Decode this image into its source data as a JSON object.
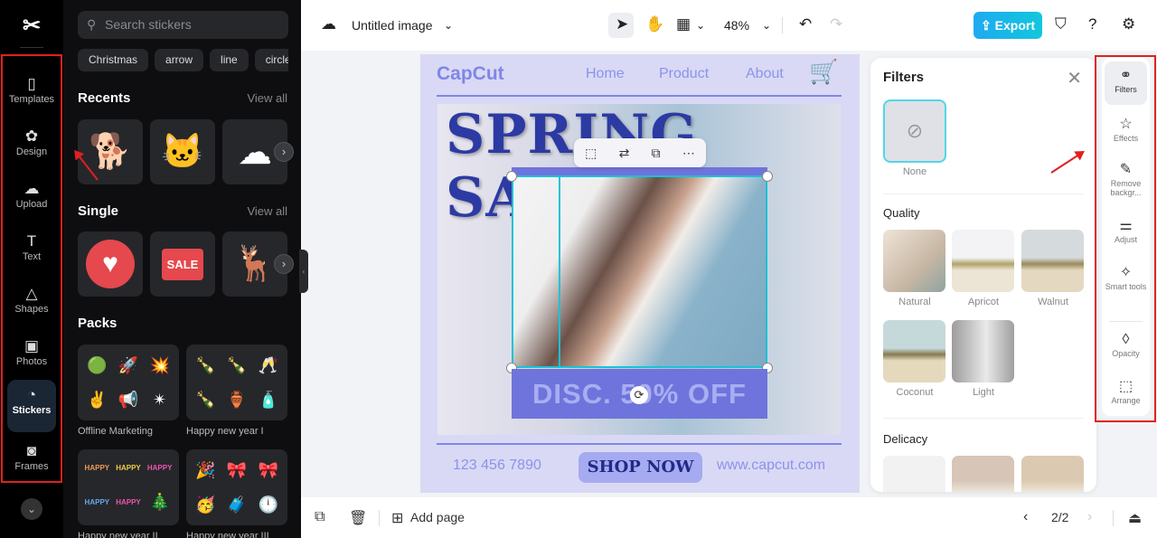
{
  "app": {
    "logo": "CapCut"
  },
  "rail": {
    "items": [
      {
        "label": "Templates",
        "icon": "templates-icon"
      },
      {
        "label": "Design",
        "icon": "design-icon"
      },
      {
        "label": "Upload",
        "icon": "upload-icon"
      },
      {
        "label": "Text",
        "icon": "text-icon"
      },
      {
        "label": "Shapes",
        "icon": "shapes-icon"
      },
      {
        "label": "Photos",
        "icon": "photos-icon"
      },
      {
        "label": "Stickers",
        "icon": "stickers-icon",
        "active": true
      },
      {
        "label": "Frames",
        "icon": "frames-icon"
      }
    ]
  },
  "stickers": {
    "search_placeholder": "Search stickers",
    "chips": [
      "Christmas",
      "arrow",
      "line",
      "circle"
    ],
    "recents": {
      "title": "Recents",
      "view_all": "View all"
    },
    "single": {
      "title": "Single",
      "view_all": "View all"
    },
    "packs": {
      "title": "Packs",
      "items": [
        "Offline Marketing",
        "Happy new year I",
        "Happy new year II",
        "Happy new year III"
      ]
    }
  },
  "topbar": {
    "title": "Untitled image",
    "zoom": "48%",
    "export_label": "Export"
  },
  "poster": {
    "logo": "CapCut",
    "nav": [
      "Home",
      "Product",
      "About"
    ],
    "headline": "SPRING SALE",
    "discount": "DISC. 50% OFF",
    "phone": "123 456 7890",
    "cta": "SHOP NOW",
    "url": "www.capcut.com"
  },
  "filters": {
    "title": "Filters",
    "none_label": "None",
    "sections": [
      {
        "title": "Quality",
        "items": [
          "Natural",
          "Apricot",
          "Walnut",
          "Coconut",
          "Light"
        ]
      },
      {
        "title": "Delicacy",
        "items": []
      }
    ]
  },
  "tools": {
    "items": [
      {
        "label": "Filters",
        "active": true
      },
      {
        "label": "Effects"
      },
      {
        "label": "Remove backgr..."
      },
      {
        "label": "Adjust"
      },
      {
        "label": "Smart tools"
      },
      {
        "label": "Opacity"
      },
      {
        "label": "Arrange"
      }
    ]
  },
  "bottombar": {
    "add_page": "Add page",
    "page_indicator": "2/2"
  }
}
